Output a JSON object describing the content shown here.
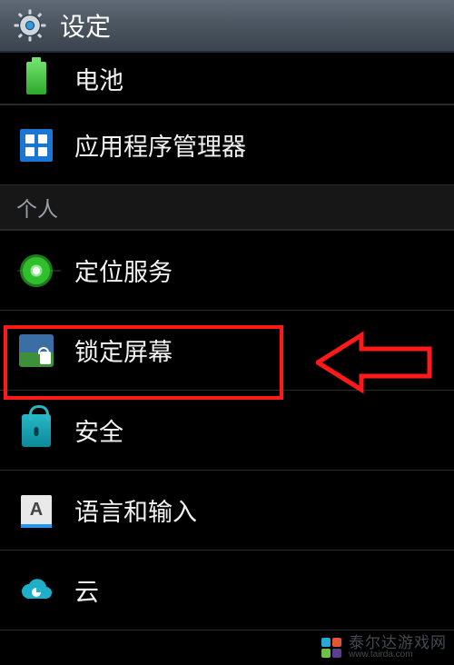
{
  "header": {
    "title": "设定"
  },
  "items": {
    "battery": "电池",
    "app_manager": "应用程序管理器",
    "section_personal": "个人",
    "location": "定位服务",
    "lock_screen": "锁定屏幕",
    "security": "安全",
    "language_input": "语言和输入",
    "cloud": "云"
  },
  "lang_glyph": "A",
  "watermark": {
    "text": "泰尔达游戏网",
    "url": "www.tairda.com"
  },
  "annotation": {
    "highlight": "lock_screen",
    "arrow_color": "#ff1a1a"
  }
}
